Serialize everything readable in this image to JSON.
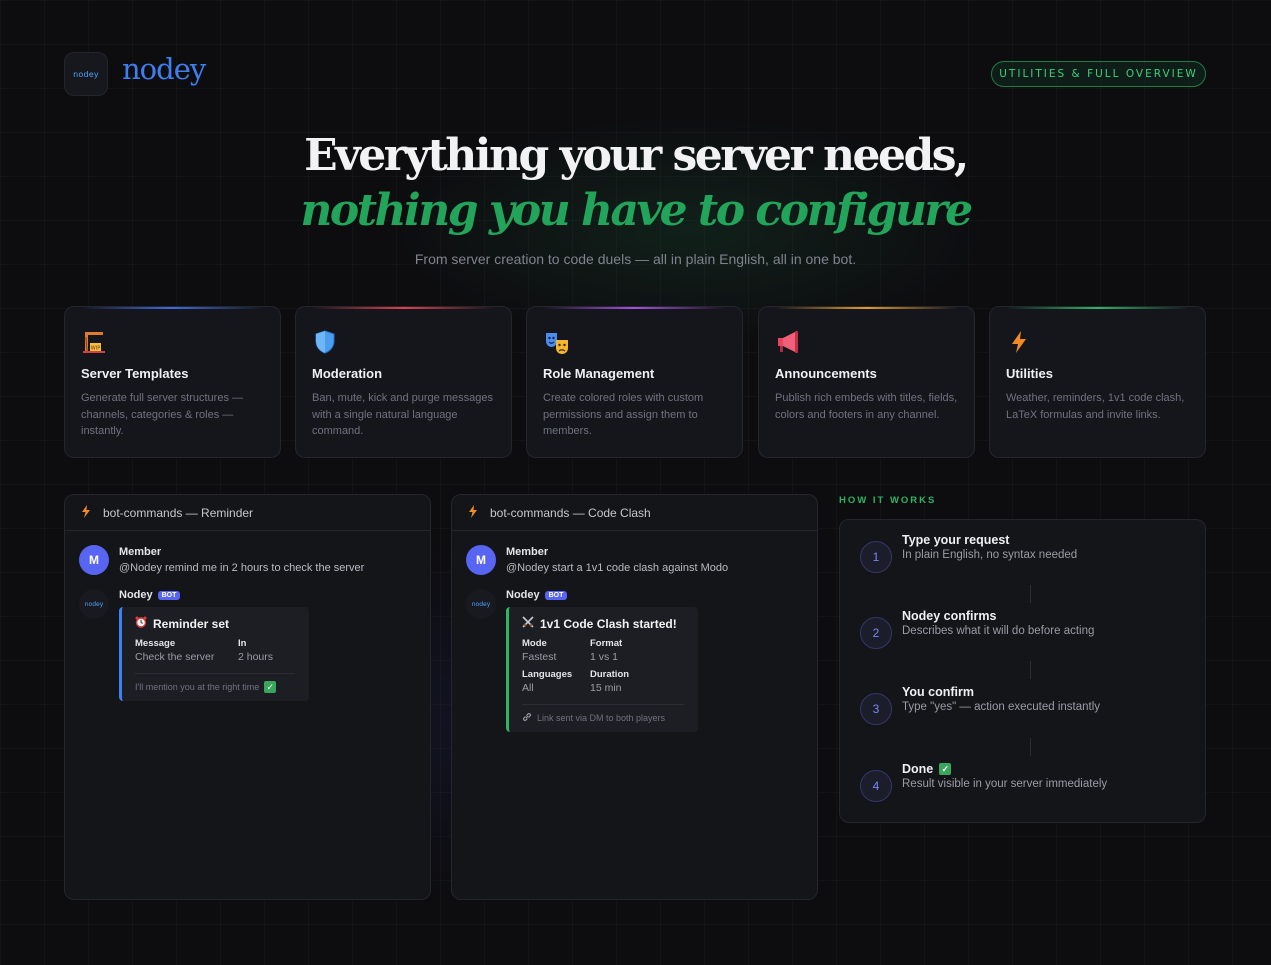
{
  "header": {
    "logo_text": "nodey",
    "brand": "nodey",
    "pill": "UTILITIES & FULL OVERVIEW"
  },
  "hero": {
    "line1": "Everything your server needs,",
    "line2": "nothing you have to configure",
    "subtitle": "From server creation to code duels — all in plain English, all in one bot."
  },
  "features": [
    {
      "title": "Server Templates",
      "desc": "Generate full server structures — channels, categories & roles — instantly.",
      "icon": "construction-crane-icon",
      "accent": "#3f6ae0"
    },
    {
      "title": "Moderation",
      "desc": "Ban, mute, kick and purge messages with a single natural language command.",
      "icon": "shield-icon",
      "accent": "#e0404a"
    },
    {
      "title": "Role Management",
      "desc": "Create colored roles with custom permissions and assign them to members.",
      "icon": "theater-masks-icon",
      "accent": "#a64fe0"
    },
    {
      "title": "Announcements",
      "desc": "Publish rich embeds with titles, fields, colors and footers in any channel.",
      "icon": "megaphone-icon",
      "accent": "#e09a2c"
    },
    {
      "title": "Utilities",
      "desc": "Weather, reminders, 1v1 code clash, LaTeX formulas and invite links.",
      "icon": "lightning-bolt-icon",
      "accent": "#2fb364"
    }
  ],
  "chat_reminder": {
    "header": "bot-commands — Reminder",
    "user_avatar": "M",
    "user_name": "Member",
    "user_message": "@Nodey remind me in 2 hours to check the server",
    "bot_name": "Nodey",
    "bot_badge": "BOT",
    "bot_avatar_text": "nodey",
    "embed_title": "Reminder set",
    "embed_icon": "alarm-clock-icon",
    "fields": [
      {
        "name": "Message",
        "value": "Check the server"
      },
      {
        "name": "In",
        "value": "2 hours"
      }
    ],
    "footer": "I'll mention you at the right time",
    "accent": "#3b82f6"
  },
  "chat_clash": {
    "header": "bot-commands — Code Clash",
    "user_avatar": "M",
    "user_name": "Member",
    "user_message": "@Nodey start a 1v1 code clash against Modo",
    "bot_name": "Nodey",
    "bot_badge": "BOT",
    "bot_avatar_text": "nodey",
    "embed_title": "1v1 Code Clash started!",
    "embed_icon": "crossed-swords-icon",
    "fields": [
      {
        "name": "Mode",
        "value": "Fastest"
      },
      {
        "name": "Format",
        "value": "1 vs 1"
      },
      {
        "name": "Languages",
        "value": "All"
      },
      {
        "name": "Duration",
        "value": "15 min"
      }
    ],
    "footer": "Link sent via DM to both players",
    "accent": "#2fb364"
  },
  "how_it_works": {
    "label": "HOW IT WORKS",
    "steps": [
      {
        "num": "1",
        "title": "Type your request",
        "desc": "In plain English, no syntax needed"
      },
      {
        "num": "2",
        "title": "Nodey confirms",
        "desc": "Describes what it will do before acting"
      },
      {
        "num": "3",
        "title": "You confirm",
        "desc": "Type \"yes\" — action executed instantly"
      },
      {
        "num": "4",
        "title": "Done",
        "desc": "Result visible in your server immediately"
      }
    ]
  }
}
